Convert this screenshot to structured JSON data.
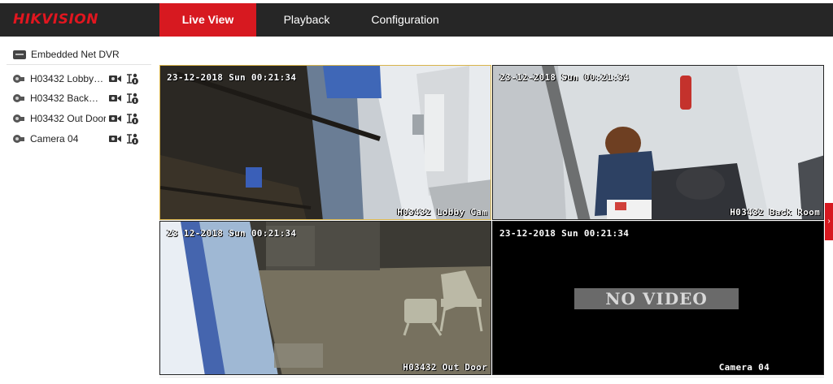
{
  "header": {
    "logo_brand": "HIK",
    "logo_rest": "VISION",
    "tabs": [
      {
        "label": "Live View",
        "active": true
      },
      {
        "label": "Playback",
        "active": false
      },
      {
        "label": "Configuration",
        "active": false
      }
    ]
  },
  "sidebar": {
    "device_name": "Embedded Net DVR",
    "cameras": [
      {
        "label": "H03432 Lobby…"
      },
      {
        "label": "H03432 Back…"
      },
      {
        "label": "H03432 Out Door"
      },
      {
        "label": "Camera 04"
      }
    ]
  },
  "grid": {
    "tiles": [
      {
        "timestamp": "23-12-2018 Sun 00:21:34",
        "name": "H03432 Lobby Cam",
        "selected": true
      },
      {
        "timestamp": "23-12-2018 Sun 00:21:34",
        "name": "H03432 Back Room",
        "selected": false
      },
      {
        "timestamp": "23 12-2018 Sun 00:21:34",
        "name": "H03432 Out Door",
        "selected": false
      },
      {
        "timestamp": "23-12-2018 Sun 00:21:34",
        "name": "Camera 04",
        "no_video_text": "NO VIDEO",
        "selected": false
      }
    ]
  },
  "colors": {
    "accent": "#d71920",
    "topbar": "#262626",
    "selected_border": "#d9b44a"
  },
  "icons": {
    "collapse_handle": "chevron-right-icon",
    "device": "dvr-icon",
    "camera": "camera-icon",
    "record": "record-icon",
    "ptz": "ptz-icon"
  }
}
